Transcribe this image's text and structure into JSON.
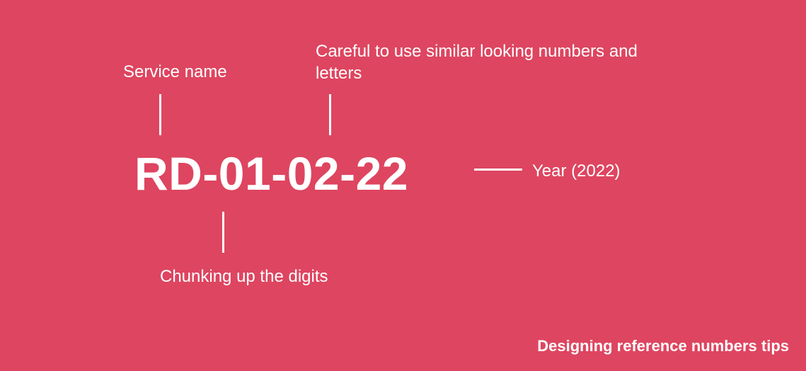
{
  "reference_number": "RD-01-02-22",
  "labels": {
    "service_name": "Service name",
    "careful_similar": "Careful to use similar looking numbers and letters",
    "chunking": "Chunking up the digits",
    "year": "Year (2022)"
  },
  "caption": "Designing reference numbers tips",
  "colors": {
    "background": "#de4560",
    "text": "#ffffff"
  }
}
